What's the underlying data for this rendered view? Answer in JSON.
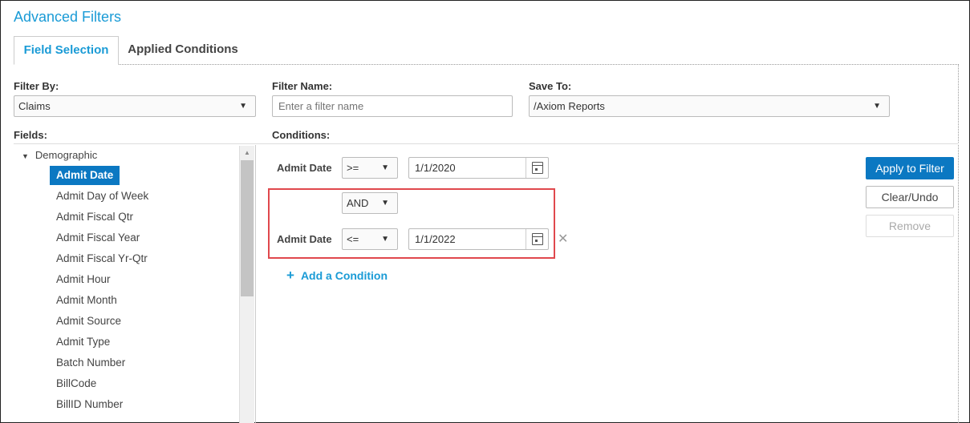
{
  "title": "Advanced Filters",
  "tabs": [
    {
      "label": "Field Selection",
      "active": true
    },
    {
      "label": "Applied Conditions",
      "active": false
    }
  ],
  "filter_by": {
    "label": "Filter By:",
    "value": "Claims"
  },
  "filter_name": {
    "label": "Filter Name:",
    "placeholder": "Enter a filter name"
  },
  "save_to": {
    "label": "Save To:",
    "value": "/Axiom Reports"
  },
  "fields": {
    "label": "Fields:",
    "group": "Demographic",
    "items": [
      "Admit Date",
      "Admit Day of Week",
      "Admit Fiscal Qtr",
      "Admit Fiscal Year",
      "Admit Fiscal Yr-Qtr",
      "Admit Hour",
      "Admit Month",
      "Admit Source",
      "Admit Type",
      "Batch Number",
      "BillCode",
      "BillID Number"
    ],
    "selected_index": 0
  },
  "conditions": {
    "label": "Conditions:",
    "rows": [
      {
        "field": "Admit Date",
        "operator": ">=",
        "value": "1/1/2020"
      },
      {
        "field": "Admit Date",
        "operator": "<=",
        "value": "1/1/2022"
      }
    ],
    "joiner": "AND",
    "add_label": "Add a Condition"
  },
  "buttons": {
    "apply": "Apply to Filter",
    "clear": "Clear/Undo",
    "remove": "Remove"
  },
  "colors": {
    "accent": "#1a9bd6",
    "primary_button": "#0b78c2",
    "highlight_border": "#e0484d"
  }
}
